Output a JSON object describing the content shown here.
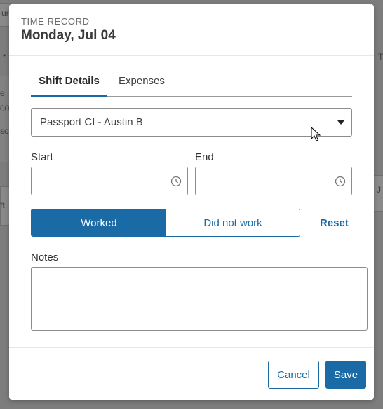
{
  "background": {
    "fragments": [
      "ur",
      "•",
      "e",
      "00",
      "so",
      "ft",
      "T",
      "J"
    ]
  },
  "modal": {
    "eyebrow": "TIME RECORD",
    "title": "Monday, Jul 04",
    "tabs": [
      {
        "label": "Shift Details",
        "active": true
      },
      {
        "label": "Expenses",
        "active": false
      }
    ],
    "assignment": {
      "selected": "Passport CI - Austin B"
    },
    "start": {
      "label": "Start",
      "value": "",
      "icon": "clock-icon"
    },
    "end": {
      "label": "End",
      "value": "",
      "icon": "clock-icon"
    },
    "status_toggle": {
      "options": [
        "Worked",
        "Did not work"
      ],
      "selected": "Worked"
    },
    "reset_label": "Reset",
    "notes": {
      "label": "Notes",
      "value": ""
    },
    "footer": {
      "cancel_label": "Cancel",
      "save_label": "Save"
    }
  },
  "colors": {
    "accent": "#1a6aa6",
    "overlay": "#7d7d7d",
    "text": "#3b3b3b"
  }
}
